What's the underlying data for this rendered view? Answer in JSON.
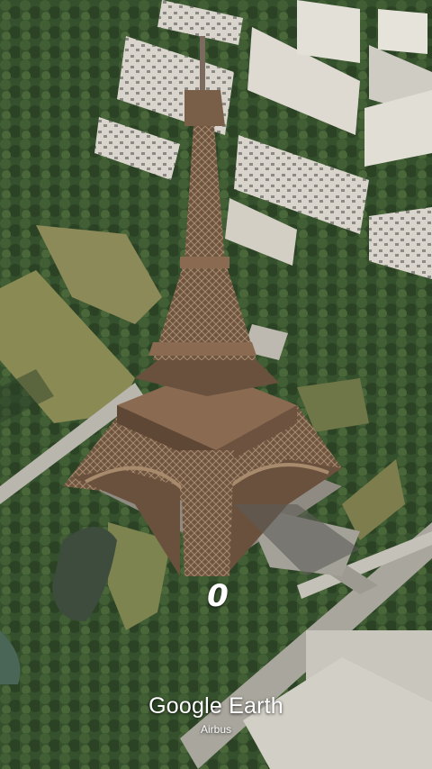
{
  "overlay": {
    "counter": "0",
    "brand": "Google Earth",
    "credit": "Airbus"
  },
  "colors": {
    "trees": "#35502c",
    "lawn": "#8a8a55",
    "buildings": "#d9d5cc",
    "roofs": "#7d7b76",
    "roads": "#b9b6ad",
    "tower": "#7a5f48",
    "water": "#3e4c3e"
  }
}
